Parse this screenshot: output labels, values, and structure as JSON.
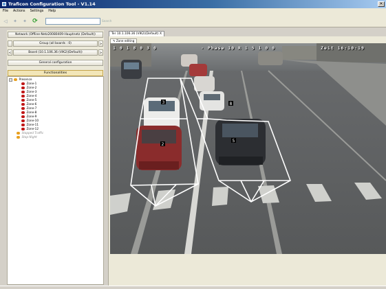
{
  "window": {
    "title": "Traficon Configuration Tool - V1.14",
    "close_glyph": "✕"
  },
  "menu": [
    "File",
    "Actions",
    "Settings",
    "Help"
  ],
  "toolbar": {
    "search_placeholder": "",
    "search_label": "Search",
    "icons": [
      "back-icon",
      "forward-icon",
      "up-icon",
      "refresh-icon"
    ]
  },
  "left": {
    "network_label": "Network (Offline-Netz20080409-Hauptnetz (Default))",
    "group_label": "Group (all boards : 0)",
    "board_label": "Board (10.1.106.36 (VIK2)(Default))",
    "general_label": "General configuration",
    "functionalities_label": "Functionalities",
    "prev_glyph": "<",
    "next_glyph": ">",
    "tree": {
      "presence_label": "Presence",
      "zones": [
        "Zone-1",
        "Zone-2",
        "Zone-3",
        "Zone-4",
        "Zone-5",
        "Zone-6",
        "Zone-7",
        "Zone-8",
        "Zone-9",
        "Zone-10",
        "Zone-11",
        "Zone-12"
      ],
      "extra": [
        "Stopped Traffic",
        "Stop-Night"
      ]
    }
  },
  "tabs": {
    "main": "Ter 10.1.106.36 (VIK2)(Default) X",
    "sub": "Zone editing"
  },
  "video": {
    "osd_left": "1 0 1 8 0 3 0",
    "osd_mid": "- Phase 10 R 1 5 1 0 0",
    "osd_right": "Zeit 16:10:19",
    "zone_labels": [
      "3",
      "2",
      "5",
      "8"
    ]
  },
  "colors": {
    "zone_outline": "#ffffff",
    "zone_active": "#c01818",
    "tree_disabled": "#8a8a8a"
  }
}
